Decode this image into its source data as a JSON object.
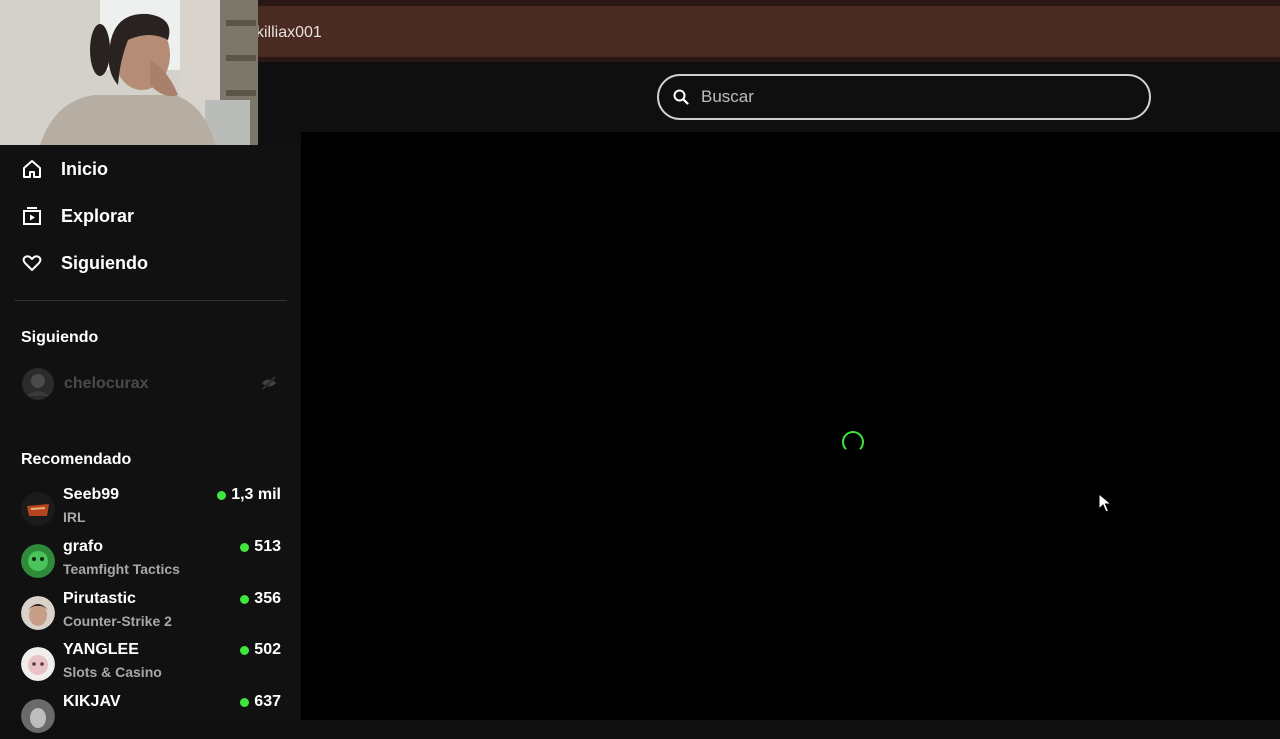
{
  "banner": {
    "text": "killiax001"
  },
  "search": {
    "placeholder": "Buscar",
    "icon": "search-icon"
  },
  "nav": [
    {
      "label": "Inicio",
      "icon": "home-icon"
    },
    {
      "label": "Explorar",
      "icon": "explore-icon"
    },
    {
      "label": "Siguiendo",
      "icon": "heart-icon"
    }
  ],
  "following": {
    "title": "Siguiendo",
    "channels": [
      {
        "name": "chelocurax",
        "icon": "hidden-eye-icon"
      }
    ]
  },
  "recommended": {
    "title": "Recomendado",
    "channels": [
      {
        "name": "Seeb99",
        "category": "IRL",
        "viewers": "1,3 mil"
      },
      {
        "name": "grafo",
        "category": "Teamfight Tactics",
        "viewers": "513"
      },
      {
        "name": "Pirutastic",
        "category": "Counter-Strike 2",
        "viewers": "356"
      },
      {
        "name": "YANGLEE",
        "category": "Slots & Casino",
        "viewers": "502"
      },
      {
        "name": "KIKJAV",
        "category": "",
        "viewers": "637"
      }
    ]
  },
  "colors": {
    "live": "#3ee63e",
    "banner": "#4a2b22",
    "background": "#0f0f0f"
  }
}
